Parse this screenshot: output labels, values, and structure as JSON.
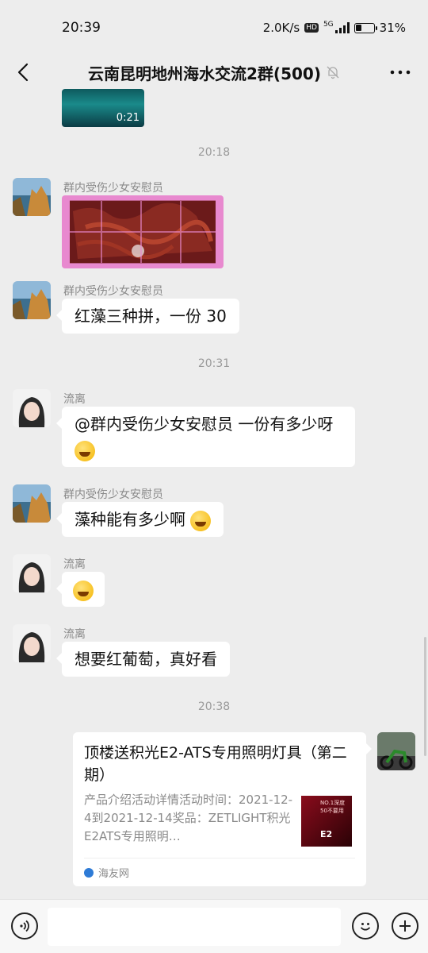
{
  "status": {
    "time": "20:39",
    "network_speed": "2.0K/s",
    "hd": "HD",
    "network_type": "5G",
    "battery": "31%",
    "battery_level": 0.31
  },
  "header": {
    "title": "云南昆明地州海水交流2群(500)",
    "back_icon": "chevron-left-icon",
    "mute_icon": "bell-off-icon",
    "more_icon": "more-dots-icon"
  },
  "messages": {
    "video": {
      "duration": "0:21"
    },
    "ts1": "20:18",
    "m1": {
      "sender": "群内受伤少女安慰员"
    },
    "m2": {
      "sender": "群内受伤少女安慰员",
      "text": "红藻三种拼，一份 30"
    },
    "ts2": "20:31",
    "m3": {
      "sender": "流离",
      "text": "@群内受伤少女安慰员  一份有多少呀"
    },
    "m4": {
      "sender": "群内受伤少女安慰员",
      "text": "藻种能有多少啊"
    },
    "m5": {
      "sender": "流离"
    },
    "m6": {
      "sender": "流离",
      "text": "想要红葡萄，真好看"
    },
    "ts3": "20:38",
    "card": {
      "title": "顶楼送积光E2-ATS专用照明灯具（第二期）",
      "desc": "产品介绍活动详情活动时间：2021-12-4到2021-12-14奖品：ZETLIGHT积光E2ATS专用照明…",
      "source": "海友网",
      "thumb_text": "NO.1深度50不要用",
      "thumb_model": "E2"
    }
  },
  "input": {
    "placeholder": ""
  },
  "colors": {
    "background": "#ededed",
    "bubble": "#ffffff",
    "meta_text": "#8a8a8a"
  }
}
